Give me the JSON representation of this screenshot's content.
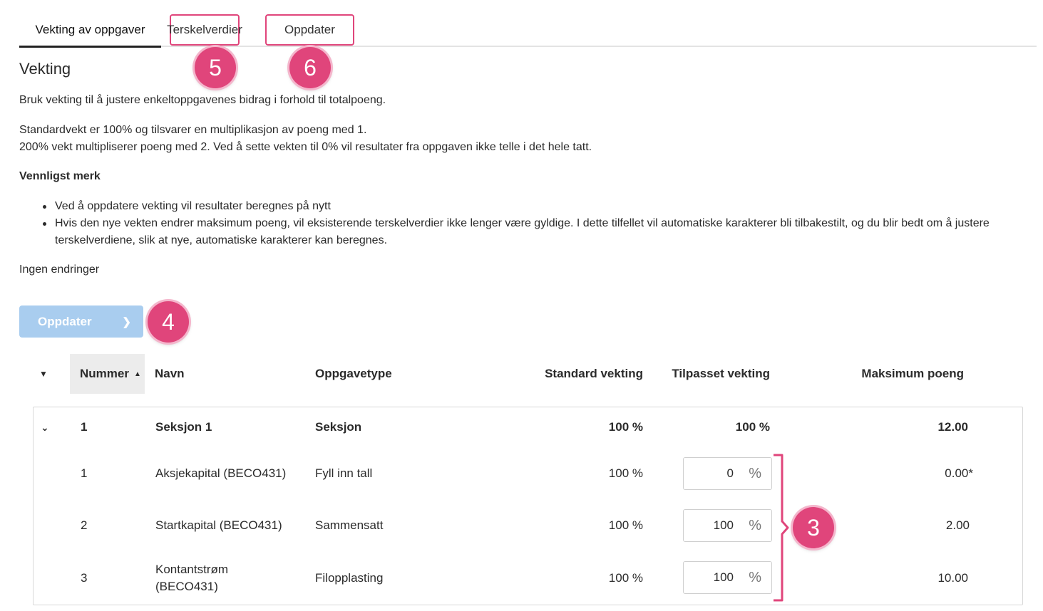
{
  "tabs": [
    {
      "label": "Vekting av oppgaver"
    },
    {
      "label": "Terskelverdier"
    },
    {
      "label": "Oppdater"
    }
  ],
  "callouts": [
    "5",
    "6",
    "4",
    "3"
  ],
  "heading": "Vekting",
  "intro": "Bruk vekting til å justere enkeltoppgavenes bidrag i forhold til totalpoeng.",
  "standard_line1": "Standardvekt er 100% og tilsvarer en multiplikasjon av poeng med 1.",
  "standard_line2": "200% vekt multipliserer poeng med 2. Ved å sette vekten til 0% vil resultater fra oppgaven ikke telle i det hele tatt.",
  "notice_title": "Vennligst merk",
  "notes": [
    "Ved å oppdatere vekting vil resultater beregnes på nytt",
    "Hvis den nye vekten endrer maksimum poeng, vil eksisterende terskelverdier ikke lenger være gyldige. I dette tilfellet vil automatiske karakterer bli tilbakestilt, og du blir bedt om å justere terskelverdiene, slik at nye, automatiske karakterer kan beregnes."
  ],
  "status": "Ingen endringer",
  "update_button": {
    "label": "Oppdater",
    "disabled": true
  },
  "columns": {
    "nummer": "Nummer",
    "navn": "Navn",
    "type": "Oppgavetype",
    "standard": "Standard vekting",
    "tilpasset": "Tilpasset vekting",
    "maks": "Maksimum poeng"
  },
  "section": {
    "nummer": "1",
    "navn": "Seksjon 1",
    "type": "Seksjon",
    "standard": "100 %",
    "tilpasset": "100 %",
    "maks": "12.00"
  },
  "rows": [
    {
      "nummer": "1",
      "navn": "Aksjekapital (BECO431)",
      "type": "Fyll inn tall",
      "standard": "100 %",
      "tilpasset": "0",
      "maks": "0.00*"
    },
    {
      "nummer": "2",
      "navn": "Startkapital (BECO431)",
      "type": "Sammensatt",
      "standard": "100 %",
      "tilpasset": "100",
      "maks": "2.00"
    },
    {
      "nummer": "3",
      "navn": "Kontantstrøm (BECO431)",
      "type": "Filopplasting",
      "standard": "100 %",
      "tilpasset": "100",
      "maks": "10.00"
    }
  ],
  "percent_symbol": "%",
  "colors": {
    "accent": "#e0457b",
    "button_disabled": "#a9cdef"
  }
}
